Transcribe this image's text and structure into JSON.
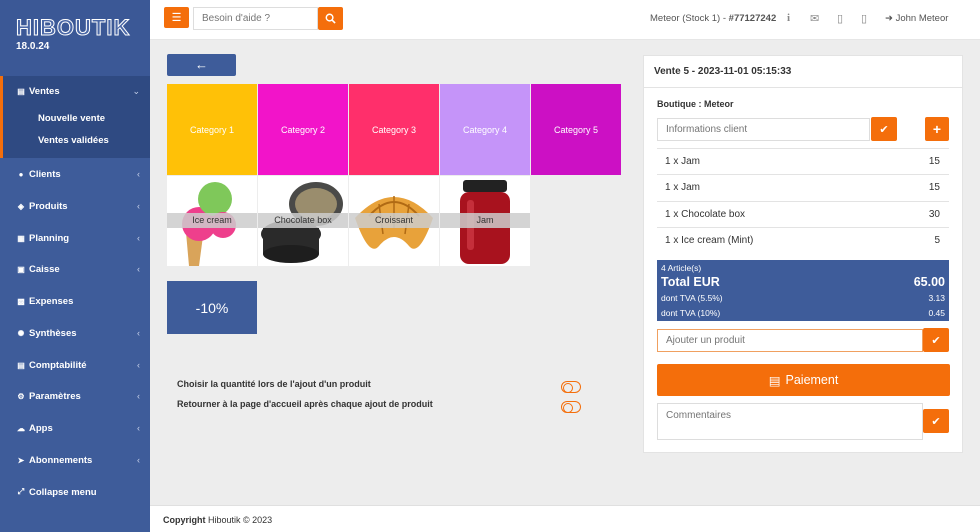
{
  "app": {
    "logo_text": "HIBOUTIK",
    "version": "18.0.24"
  },
  "sidebar": {
    "items": [
      {
        "label": "Ventes",
        "icon": "register-icon",
        "chevron": "⌄"
      },
      {
        "label": "Clients",
        "icon": "user-icon",
        "chevron": "‹"
      },
      {
        "label": "Produits",
        "icon": "tag-icon",
        "chevron": "‹"
      },
      {
        "label": "Planning",
        "icon": "calendar-icon",
        "chevron": "‹"
      },
      {
        "label": "Caisse",
        "icon": "cash-icon",
        "chevron": "‹"
      },
      {
        "label": "Expenses",
        "icon": "briefcase-icon",
        "chevron": ""
      },
      {
        "label": "Synthèses",
        "icon": "chart-icon",
        "chevron": "‹"
      },
      {
        "label": "Comptabilité",
        "icon": "ledger-icon",
        "chevron": "‹"
      },
      {
        "label": "Paramètres",
        "icon": "gears-icon",
        "chevron": "‹"
      },
      {
        "label": "Apps",
        "icon": "cloud-icon",
        "chevron": "‹"
      },
      {
        "label": "Abonnements",
        "icon": "rocket-icon",
        "chevron": "‹"
      },
      {
        "label": "Collapse menu",
        "icon": "expand-icon",
        "chevron": ""
      }
    ],
    "subitems": [
      "Nouvelle vente",
      "Ventes validées"
    ]
  },
  "topbar": {
    "help_placeholder": "Besoin d'aide ?",
    "store_label": "Meteor (Stock 1) - ",
    "store_id": "#77127242",
    "user_name": "John Meteor"
  },
  "categories": [
    {
      "label": "Category 1",
      "color": "#ffc107"
    },
    {
      "label": "Category 2",
      "color": "#f214c9"
    },
    {
      "label": "Category 3",
      "color": "#ff2f6b"
    },
    {
      "label": "Category 4",
      "color": "#c594f9"
    },
    {
      "label": "Category 5",
      "color": "#cc10c4"
    }
  ],
  "products": [
    {
      "label": "Ice cream",
      "icon": "ice-cream-icon"
    },
    {
      "label": "Chocolate box",
      "icon": "chocolate-box-icon"
    },
    {
      "label": "Croissant",
      "icon": "croissant-icon"
    },
    {
      "label": "Jam",
      "icon": "jam-jar-icon"
    }
  ],
  "discount": {
    "label": "-10%"
  },
  "options": [
    {
      "label": "Choisir la quantité lors de l'ajout d'un produit"
    },
    {
      "label": "Retourner à la page d'accueil après chaque ajout de produit"
    }
  ],
  "sale": {
    "title": "Vente 5 - 2023-11-01 05:15:33",
    "shop": "Boutique : Meteor",
    "client_placeholder": "Informations client",
    "lines": [
      {
        "item": "1 x Jam",
        "amount": "15"
      },
      {
        "item": "1 x Jam",
        "amount": "15"
      },
      {
        "item": "1 x Chocolate box",
        "amount": "30"
      },
      {
        "item": "1 x Ice cream (Mint)",
        "amount": "5"
      }
    ],
    "summary": {
      "articles": "4 Article(s)",
      "total_label": "Total EUR",
      "total_value": "65.00",
      "tva1_label": "dont TVA (5.5%)",
      "tva1_value": "3.13",
      "tva2_label": "dont TVA (10%)",
      "tva2_value": "0.45"
    },
    "add_product_placeholder": "Ajouter un produit",
    "pay_label": "Paiement",
    "comments_placeholder": "Commentaires"
  },
  "footer": {
    "copyright_bold": "Copyright",
    "copyright_rest": " Hiboutik © 2023"
  },
  "colors": {
    "accent": "#f46e0b",
    "primary": "#3e5c9a"
  }
}
